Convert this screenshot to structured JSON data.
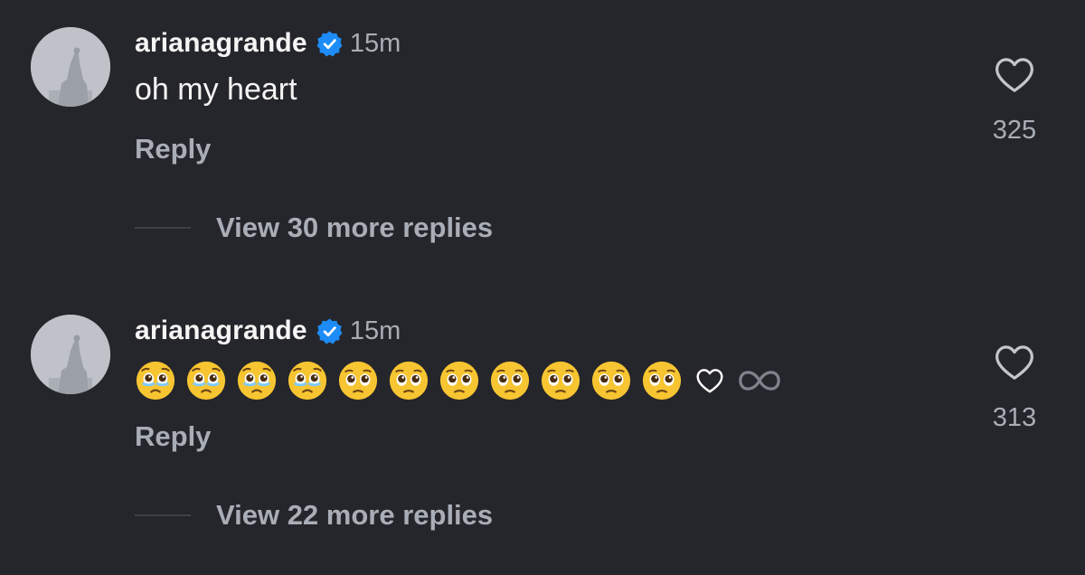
{
  "comments": [
    {
      "username": "arianagrande",
      "verified": true,
      "time": "15m",
      "text": "oh my heart",
      "reply_label": "Reply",
      "view_more_label": "View 30 more replies",
      "like_count": "325"
    },
    {
      "username": "arianagrande",
      "verified": true,
      "time": "15m",
      "emojis": [
        "face-holding-back-tears",
        "face-holding-back-tears",
        "face-holding-back-tears",
        "face-holding-back-tears",
        "pleading-face",
        "pleading-face",
        "pleading-face",
        "pleading-face",
        "pleading-face",
        "pleading-face",
        "pleading-face",
        "white-heart",
        "infinity"
      ],
      "reply_label": "Reply",
      "view_more_label": "View 22 more replies",
      "like_count": "313"
    }
  ],
  "colors": {
    "background": "#25262b",
    "primary_text": "#f5f5f5",
    "secondary_text": "#a8adb6",
    "verified_badge": "#1d8cf8",
    "emoji_yellow": "#f7c531"
  }
}
